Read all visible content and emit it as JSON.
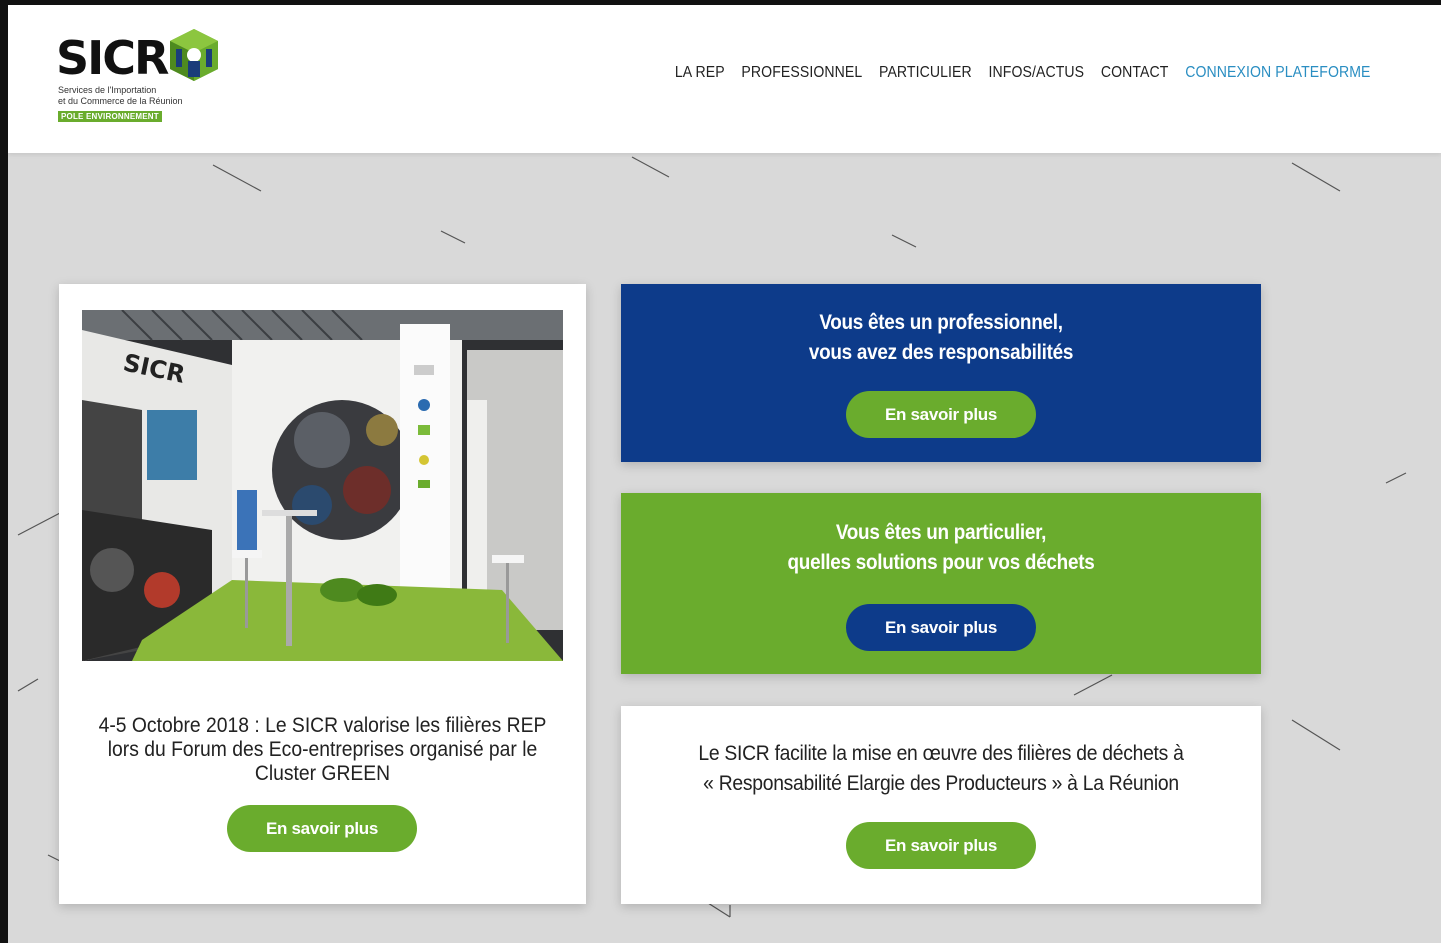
{
  "header": {
    "logo": {
      "wordmark": "SICR",
      "subtitle_line1": "Services de l'Importation",
      "subtitle_line2": "et du Commerce de la Réunion",
      "badge": "POLE ENVIRONNEMENT"
    },
    "nav": [
      {
        "label": "LA REP"
      },
      {
        "label": "PROFESSIONNEL"
      },
      {
        "label": "PARTICULIER"
      },
      {
        "label": "INFOS/ACTUS"
      },
      {
        "label": "CONTACT"
      },
      {
        "label": "CONNEXION PLATEFORME"
      }
    ]
  },
  "news": {
    "title": "4-5 Octobre 2018 : Le SICR valorise les filières REP lors du Forum des Eco-entreprises organisé par le Cluster GREEN",
    "button": "En savoir plus"
  },
  "professional": {
    "title_line1": "Vous êtes un professionnel,",
    "title_line2": "vous avez des responsabilités",
    "button": "En savoir plus"
  },
  "individual": {
    "title_line1": "Vous êtes un particulier,",
    "title_line2": "quelles solutions pour vos déchets",
    "button": "En savoir plus"
  },
  "info": {
    "title_line1": "Le SICR facilite la mise en œuvre des filières de déchets à",
    "title_line2": "« Responsabilité Elargie des Producteurs » à La Réunion",
    "button": "En savoir plus"
  },
  "colors": {
    "brand_blue": "#0d3b8a",
    "brand_green": "#6aac2d",
    "nav_accent": "#2a8ec2",
    "background": "#d9d9d9"
  }
}
